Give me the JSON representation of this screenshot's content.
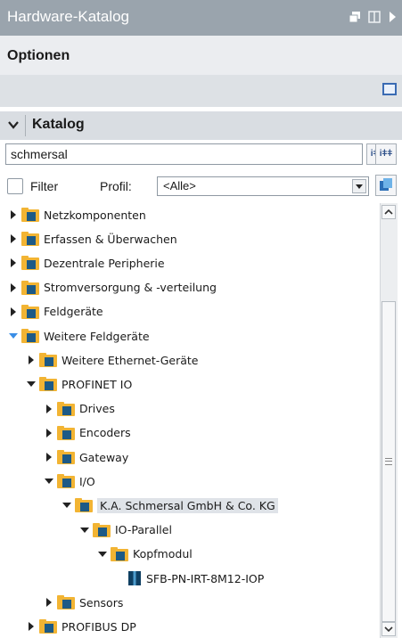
{
  "window": {
    "title": "Hardware-Katalog"
  },
  "options_section": {
    "title": "Optionen"
  },
  "catalog": {
    "title": "Katalog",
    "search_value": "schmersal",
    "search_down_label": "iǂǂ",
    "search_up_label": "iǂǂ",
    "filter_label": "Filter",
    "profile_label": "Profil:",
    "profile_value": "<Alle>"
  },
  "tree": [
    {
      "label": "Netzkomponenten",
      "level": 0,
      "state": "collapsed",
      "icon": "folder-icon"
    },
    {
      "label": "Erfassen & Überwachen",
      "level": 0,
      "state": "collapsed",
      "icon": "folder-icon"
    },
    {
      "label": "Dezentrale Peripherie",
      "level": 0,
      "state": "collapsed",
      "icon": "folder-icon"
    },
    {
      "label": "Stromversorgung & -verteilung",
      "level": 0,
      "state": "collapsed",
      "icon": "folder-icon"
    },
    {
      "label": "Feldgeräte",
      "level": 0,
      "state": "collapsed",
      "icon": "folder-icon"
    },
    {
      "label": "Weitere Feldgeräte",
      "level": 0,
      "state": "expanded",
      "icon": "folder-icon"
    },
    {
      "label": "Weitere Ethernet-Geräte",
      "level": 1,
      "state": "collapsed",
      "icon": "folder-icon"
    },
    {
      "label": "PROFINET IO",
      "level": 1,
      "state": "expanded",
      "icon": "folder-icon"
    },
    {
      "label": "Drives",
      "level": 2,
      "state": "collapsed",
      "icon": "folder-icon"
    },
    {
      "label": "Encoders",
      "level": 2,
      "state": "collapsed",
      "icon": "folder-icon"
    },
    {
      "label": "Gateway",
      "level": 2,
      "state": "collapsed",
      "icon": "folder-icon"
    },
    {
      "label": "I/O",
      "level": 2,
      "state": "expanded",
      "icon": "folder-icon"
    },
    {
      "label": "K.A. Schmersal GmbH & Co. KG",
      "level": 3,
      "state": "expanded",
      "icon": "folder-icon",
      "selected": true
    },
    {
      "label": "IO-Parallel",
      "level": 4,
      "state": "expanded",
      "icon": "folder-icon"
    },
    {
      "label": "Kopfmodul",
      "level": 5,
      "state": "expanded",
      "icon": "folder-icon"
    },
    {
      "label": "SFB-PN-IRT-8M12-IOP",
      "level": 6,
      "state": "leaf",
      "icon": "device-icon"
    },
    {
      "label": "Sensors",
      "level": 2,
      "state": "collapsed",
      "icon": "folder-icon"
    },
    {
      "label": "PROFIBUS DP",
      "level": 1,
      "state": "collapsed",
      "icon": "folder-icon"
    }
  ],
  "colors": {
    "title_bar": "#9aa4ad",
    "expander_blue": "#3a8ee6",
    "folder": "#f2b433"
  }
}
